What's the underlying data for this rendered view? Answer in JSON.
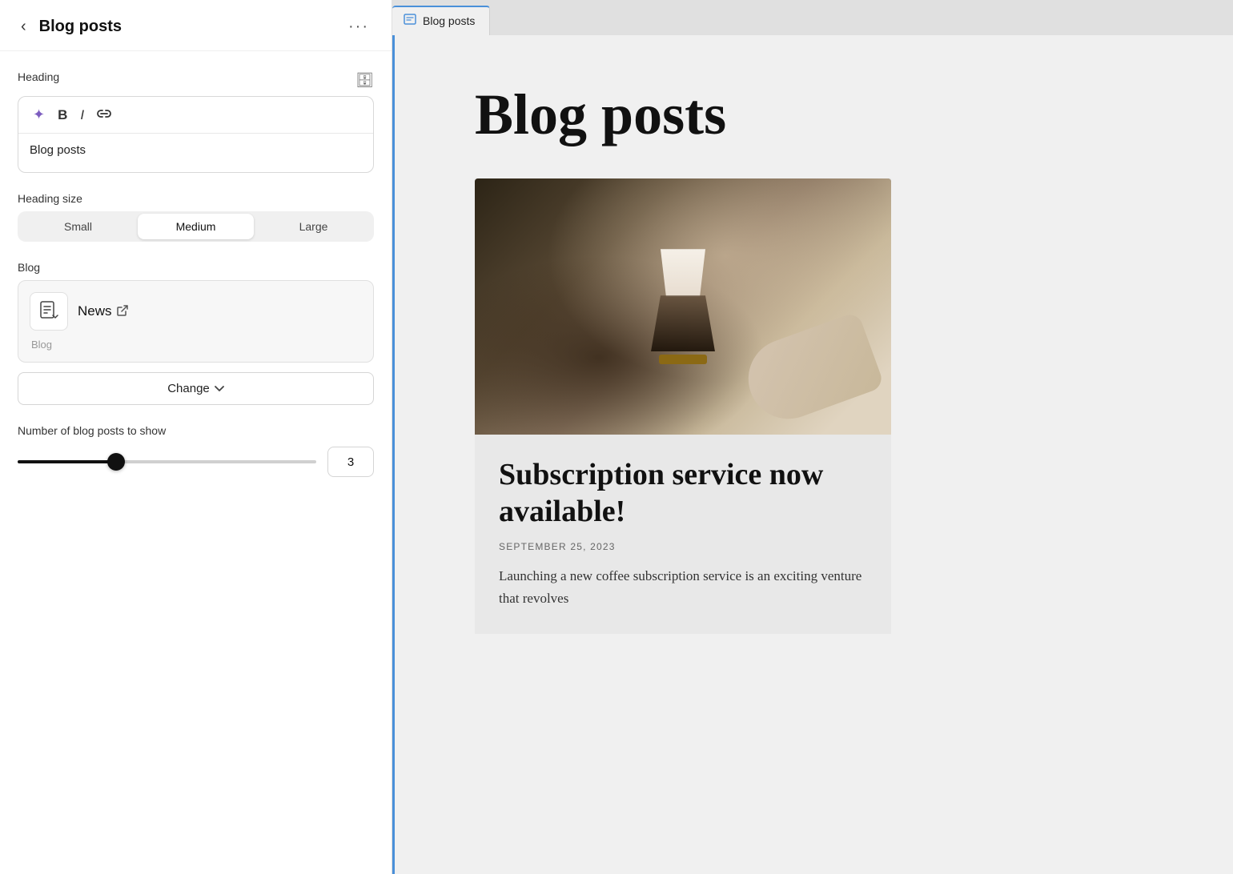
{
  "left_panel": {
    "title": "Blog posts",
    "back_label": "‹",
    "more_label": "···",
    "heading_section": {
      "label": "Heading",
      "db_icon": "🗄",
      "toolbar": {
        "sparkle_label": "✦",
        "bold_label": "B",
        "italic_label": "I",
        "link_label": "⌘"
      },
      "value": "Blog posts"
    },
    "heading_size_section": {
      "label": "Heading size",
      "sizes": [
        "Small",
        "Medium",
        "Large"
      ],
      "active": "Medium"
    },
    "blog_section": {
      "label": "Blog",
      "blog_icon": "📋",
      "blog_name": "News",
      "external_icon": "↗",
      "sub_label": "Blog",
      "change_button": "Change",
      "chevron": "∨"
    },
    "posts_count_section": {
      "label": "Number of blog posts to show",
      "value": "3",
      "slider_percent": 33
    }
  },
  "right_panel": {
    "tab_icon": "⊟",
    "tab_label": "Blog posts",
    "preview": {
      "page_title": "Blog posts",
      "post": {
        "title": "Subscription service now available!",
        "date": "September 25, 2023",
        "excerpt": "Launching a new coffee subscription service is an exciting venture that revolves"
      }
    }
  }
}
